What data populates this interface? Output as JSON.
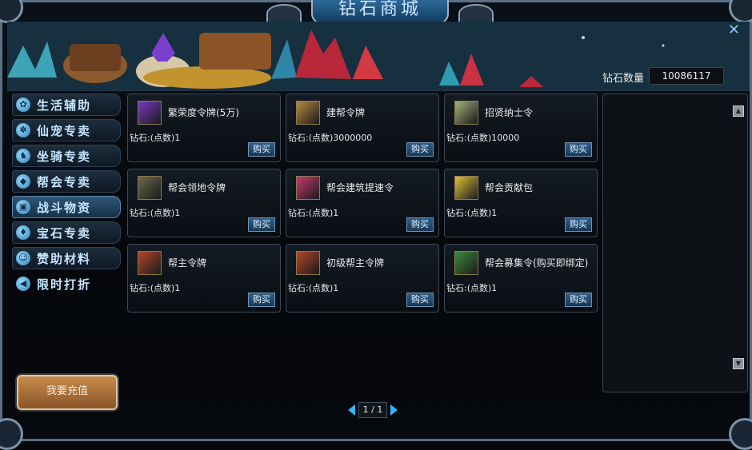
{
  "window": {
    "title": "钻石商城"
  },
  "header": {
    "diamond_label": "钻石数量",
    "diamond_value": "10086117"
  },
  "sidebar": {
    "items": [
      {
        "label": "生活辅助",
        "icon": "leaf-icon"
      },
      {
        "label": "仙宠专卖",
        "icon": "paw-icon"
      },
      {
        "label": "坐骑专卖",
        "icon": "unicorn-icon"
      },
      {
        "label": "帮会专卖",
        "icon": "shield-icon"
      },
      {
        "label": "战斗物资",
        "icon": "box-icon"
      },
      {
        "label": "宝石专卖",
        "icon": "gem-icon"
      },
      {
        "label": "赞助材料",
        "icon": "person-icon"
      },
      {
        "label": "限时打折",
        "icon": "megaphone-icon"
      }
    ],
    "active_index": 4,
    "recharge_label": "我要充值"
  },
  "items": [
    {
      "name": "繁荣度令牌(5万)",
      "price": "钻石:(点数)1",
      "buy": "购买",
      "icon_color": "#7a3ac2"
    },
    {
      "name": "建帮令牌",
      "price": "钻石:(点数)3000000",
      "buy": "购买",
      "icon_color": "#b58a3d"
    },
    {
      "name": "招贤纳士令",
      "price": "钻石:(点数)10000",
      "buy": "购买",
      "icon_color": "#a3b27a"
    },
    {
      "name": "帮会领地令牌",
      "price": "钻石:(点数)1",
      "buy": "购买",
      "icon_color": "#6c6a4e"
    },
    {
      "name": "帮会建筑提速令",
      "price": "钻石:(点数)1",
      "buy": "购买",
      "icon_color": "#c83a6e"
    },
    {
      "name": "帮会贡献包",
      "price": "钻石:(点数)1",
      "buy": "购买",
      "icon_color": "#e0c23a"
    },
    {
      "name": "帮主令牌",
      "price": "钻石:(点数)1",
      "buy": "购买",
      "icon_color": "#b2472a"
    },
    {
      "name": "初级帮主令牌",
      "price": "钻石:(点数)1",
      "buy": "购买",
      "icon_color": "#b2472a"
    },
    {
      "name": "帮会募集令(购买即绑定)",
      "price": "钻石:(点数)1",
      "buy": "购买",
      "icon_color": "#3c8a3a"
    }
  ],
  "pagination": {
    "text": "1 / 1"
  },
  "colors": {
    "accent": "#2fb8ff",
    "text": "#e9e9e9",
    "sidebar_text": "#c5e6ff"
  }
}
